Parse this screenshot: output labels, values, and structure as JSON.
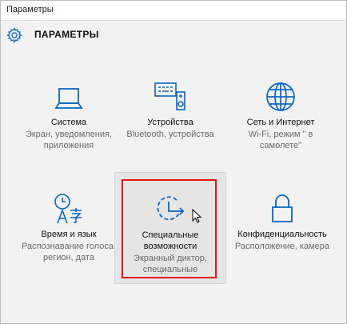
{
  "window": {
    "title": "Параметры"
  },
  "header": {
    "icon": "gear-icon",
    "heading": "ПАРАМЕТРЫ"
  },
  "accent_color": "#0a66c2",
  "tiles": [
    {
      "icon": "laptop-icon",
      "label": [
        "Система"
      ],
      "desc": [
        "Экран, уведомления,",
        "приложения"
      ]
    },
    {
      "icon": "devices-icon",
      "label": [
        "Устройства"
      ],
      "desc": [
        "Bluetooth, устройства"
      ]
    },
    {
      "icon": "globe-icon",
      "label": [
        "Сеть и Интернет"
      ],
      "desc": [
        "Wi-Fi, режим \" в",
        "самолете\""
      ]
    },
    {
      "icon": "time-language-icon",
      "label": [
        "Время и язык"
      ],
      "desc": [
        "Распознавание голоса,",
        "регион, дата"
      ]
    },
    {
      "icon": "ease-of-access-icon",
      "label": [
        "Специальные",
        "возможности"
      ],
      "desc": [
        "Экранный диктор,",
        "специальные"
      ]
    },
    {
      "icon": "lock-icon",
      "label": [
        "Конфиденциальность"
      ],
      "desc": [
        "Расположение, камера"
      ]
    }
  ]
}
